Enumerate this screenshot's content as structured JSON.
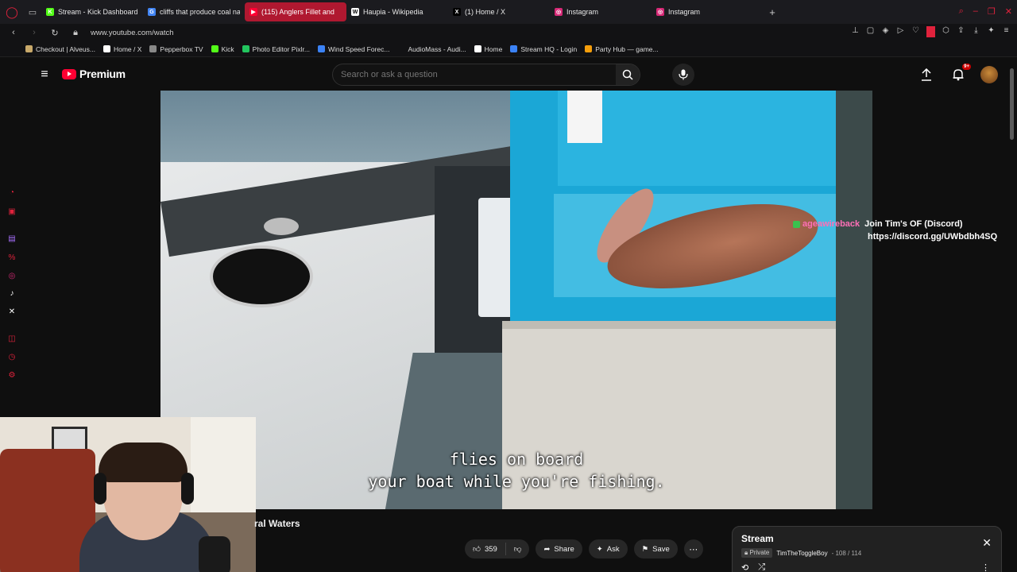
{
  "browser": {
    "tabs": [
      {
        "label": "Stream - Kick Dashboard",
        "color": "#53fc18",
        "glyph": "K",
        "active": false
      },
      {
        "label": "cliffs that produce coal nat",
        "color": "#4285f4",
        "glyph": "G",
        "active": false
      },
      {
        "label": "(115) Anglers Fillet and",
        "color": "#ff0033",
        "glyph": "▶",
        "active": true
      },
      {
        "label": "Haupia - Wikipedia",
        "color": "#ffffff",
        "glyph": "W",
        "active": false
      },
      {
        "label": "(1) Home / X",
        "color": "#000000",
        "glyph": "X",
        "active": false
      },
      {
        "label": "Instagram",
        "color": "#d62976",
        "glyph": "◎",
        "active": false
      },
      {
        "label": "Instagram",
        "color": "#d62976",
        "glyph": "◎",
        "active": false
      }
    ],
    "url": "www.youtube.com/watch",
    "bookmarks": [
      {
        "label": "Checkout | Alveus...",
        "color": "#c8a96a"
      },
      {
        "label": "Home / X",
        "color": "#ffffff"
      },
      {
        "label": "Pepperbox TV",
        "color": "#888888"
      },
      {
        "label": "Kick",
        "color": "#53fc18"
      },
      {
        "label": "Photo Editor Pixlr...",
        "color": "#22c55e"
      },
      {
        "label": "Wind Speed Forec...",
        "color": "#3b82f6"
      },
      {
        "label": "AudioMass - Audi...",
        "color": "#121214"
      },
      {
        "label": "Home",
        "color": "#ffffff"
      },
      {
        "label": "Stream HQ - Login",
        "color": "#3b82f6"
      },
      {
        "label": "Party Hub — game...",
        "color": "#f59e0b"
      }
    ]
  },
  "youtube": {
    "logo_text": "Premium",
    "search_placeholder": "Search or ask a question",
    "notif_count": "9+",
    "video_title_partial": "ral Waters",
    "subtitle_line1": "flies on board",
    "subtitle_line2": "your boat while you're fishing.",
    "likes": "359",
    "share_label": "Share",
    "ask_label": "Ask",
    "save_label": "Save"
  },
  "chat": {
    "user": "ageawireback",
    "message": "Join Tim's OF (Discord)",
    "link": "https://discord.gg/UWbdbh4SQ"
  },
  "playlist": {
    "title": "Stream",
    "privacy": "Private",
    "owner": "TimTheToggleBoy",
    "position": "- 108 / 114"
  }
}
